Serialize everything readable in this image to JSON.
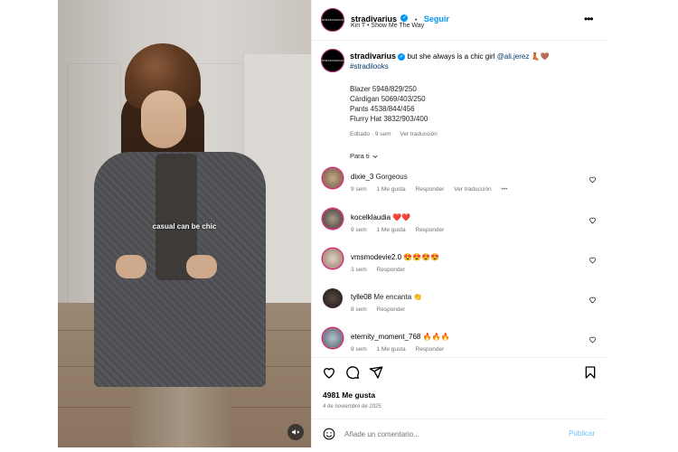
{
  "media": {
    "overlay_text": "casual can be chic",
    "mute_icon": "speaker-muted-icon"
  },
  "header": {
    "username": "stradivarius",
    "follow_label": "Seguir",
    "dot": "•",
    "audio": "Kiri T • Show Me The Way",
    "avatar_logo": "STRADIVARIUS"
  },
  "post": {
    "username": "stradivarius",
    "caption_text": "but she always is a chic girl",
    "mention": "@ali.jerez",
    "emojis": "👢🤎",
    "hashtag": "#stradilooks",
    "lines": [
      "Blazer 5948/829/250",
      "Cárdigan 5069/403/250",
      "Pants 4538/844/456",
      "Flurry Hat 3832/903/400"
    ],
    "edited": "Editado · 9 sem",
    "see_translation": "Ver traducción",
    "for_you": "Para ti"
  },
  "comments": [
    {
      "user": "dixie_3",
      "text": "Gorgeous",
      "time": "9 sem",
      "likes": "1 Me gusta",
      "reply": "Responder",
      "translation": "Ver traducción",
      "more": "•••"
    },
    {
      "user": "kocelklaudia",
      "text": "❤️❤️",
      "time": "9 sem",
      "likes": "1 Me gusta",
      "reply": "Responder"
    },
    {
      "user": "vmsmodevie2.0",
      "text": "😍😍😍😍",
      "time": "3 sem",
      "reply": "Responder"
    },
    {
      "user": "tylle08",
      "text": "Me encanta 👏",
      "time": "8 sem",
      "reply": "Responder"
    },
    {
      "user": "eternity_moment_768",
      "text": "🔥🔥🔥",
      "time": "9 sem",
      "likes": "1 Me gusta",
      "reply": "Responder"
    }
  ],
  "footer": {
    "likes": "4981 Me gusta",
    "date": "4 de noviembre de 2025",
    "comment_placeholder": "Añade un comentario...",
    "publish_label": "Publicar"
  },
  "colors": {
    "accent": "#0095f6",
    "muted": "#737373",
    "link": "#00376b",
    "heart": "#ed4956"
  }
}
